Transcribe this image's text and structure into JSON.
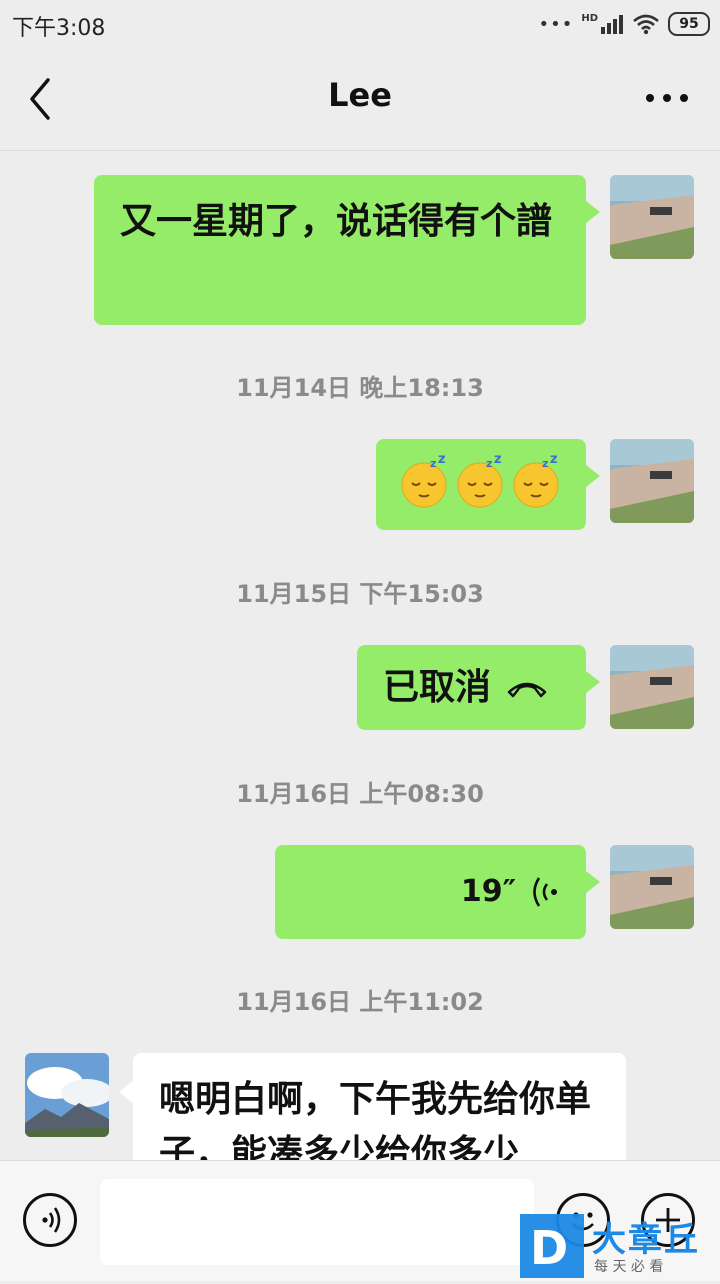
{
  "status_bar": {
    "time": "下午3:08",
    "network": "HD",
    "battery": "95"
  },
  "header": {
    "title": "Lee"
  },
  "messages": [
    {
      "sender": "me",
      "type": "text",
      "text": "又一星期了，说话得有个譜"
    },
    {
      "type": "timestamp",
      "text": "11月14日 晚上18:13"
    },
    {
      "sender": "me",
      "type": "emoji",
      "text": "😴😴😴"
    },
    {
      "type": "timestamp",
      "text": "11月15日 下午15:03"
    },
    {
      "sender": "me",
      "type": "call",
      "text": "已取消"
    },
    {
      "type": "timestamp",
      "text": "11月16日 上午08:30"
    },
    {
      "sender": "me",
      "type": "voice",
      "text": "19″"
    },
    {
      "type": "timestamp",
      "text": "11月16日 上午11:02"
    },
    {
      "sender": "other",
      "type": "text",
      "text": "嗯明白啊，下午我先给你单子，能凑多少给你多少"
    }
  ],
  "watermark": {
    "brand": "大章丘",
    "slogan": "每 天 必 看",
    "letter": "D"
  },
  "colors": {
    "bubble_me": "#95ec69",
    "bubble_other": "#ffffff",
    "background": "#ededed"
  }
}
